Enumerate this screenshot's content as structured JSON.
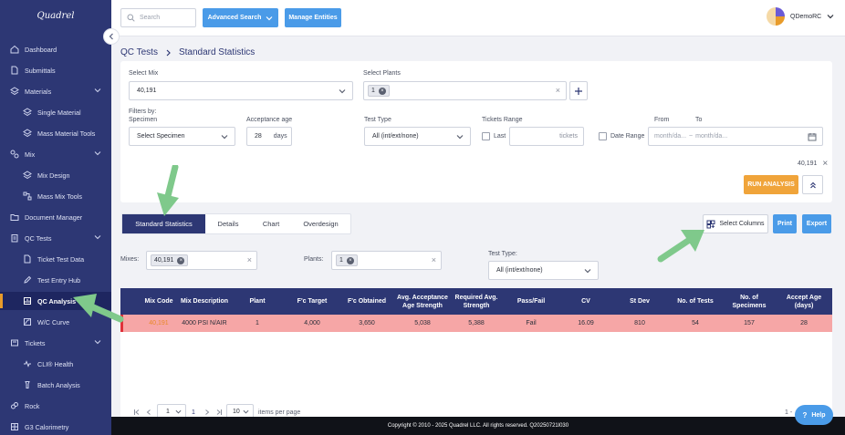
{
  "app": {
    "logo": "Quadrel"
  },
  "sidebar": {
    "items": [
      {
        "label": "Dashboard",
        "icon": "dashboard-icon"
      },
      {
        "label": "Submittals",
        "icon": "file-icon"
      },
      {
        "label": "Materials",
        "icon": "layers-icon"
      },
      {
        "label": "Single Material",
        "icon": "layers-icon"
      },
      {
        "label": "Mass Material Tools",
        "icon": "layers-icon"
      },
      {
        "label": "Mix",
        "icon": "mix-icon"
      },
      {
        "label": "Mix Design",
        "icon": "layers-icon"
      },
      {
        "label": "Mass Mix Tools",
        "icon": "tools-icon"
      },
      {
        "label": "Document Manager",
        "icon": "folder-icon"
      },
      {
        "label": "QC Tests",
        "icon": "clipboard-icon"
      },
      {
        "label": "Ticket Test Data",
        "icon": "ticket-icon"
      },
      {
        "label": "Test Entry Hub",
        "icon": "edit-icon"
      },
      {
        "label": "QC Analysis",
        "icon": "chart-icon"
      },
      {
        "label": "W/C Curve",
        "icon": "curve-icon"
      },
      {
        "label": "Tickets",
        "icon": "ticket-icon"
      },
      {
        "label": "CLI® Health",
        "icon": "health-icon"
      },
      {
        "label": "Batch Analysis",
        "icon": "batch-icon"
      },
      {
        "label": "Rock",
        "icon": "rock-icon"
      },
      {
        "label": "G3 Calorimetry",
        "icon": "grid-icon"
      }
    ]
  },
  "topbar": {
    "search_placeholder": "Search",
    "advanced_search": "Advanced Search",
    "manage_entities": "Manage Entities",
    "user_name": "QDemoRC"
  },
  "breadcrumb": {
    "parent": "QC Tests",
    "current": "Standard Statistics"
  },
  "filters": {
    "select_mix_label": "Select Mix",
    "select_mix_value": "40,191",
    "select_plants_label": "Select Plants",
    "plant_chip": "1",
    "filters_by_label": "Filters by:",
    "specimen_label": "Specimen",
    "specimen_value": "Select Specimen",
    "acceptance_age_label": "Acceptance age",
    "acceptance_age_value": "28",
    "acceptance_age_unit": "days",
    "test_type_label": "Test Type",
    "test_type_value": "All (int/ext/none)",
    "tickets_range_label": "Tickets Range",
    "last_label": "Last",
    "tickets_unit": "tickets",
    "date_range_label": "Date Range",
    "from_label": "From",
    "to_label": "To",
    "date_placeholder": "month/da...",
    "date_placeholder_2": "month/da...",
    "date_separator": "~",
    "selected_mix_tag": "40,191",
    "run_analysis": "RUN ANALYSIS"
  },
  "tabs": [
    {
      "label": "Standard Statistics",
      "active": true
    },
    {
      "label": "Details",
      "active": false
    },
    {
      "label": "Chart",
      "active": false
    },
    {
      "label": "Overdesign",
      "active": false
    }
  ],
  "actions": {
    "select_columns": "Select Columns",
    "print": "Print",
    "export": "Export"
  },
  "table_filters": {
    "mixes_label": "Mixes:",
    "mix_chip": "40,191",
    "plants_label": "Plants:",
    "plant_chip": "1",
    "test_type_label": "Test Type:",
    "test_type_value": "All (int/ext/none)"
  },
  "table": {
    "headers": [
      "Mix Code",
      "Mix Description",
      "Plant",
      "F'c Target",
      "F'c Obtained",
      "Avg. Acceptance Age Strength",
      "Required Avg. Strength",
      "Pass/Fail",
      "CV",
      "St Dev",
      "No. of Tests",
      "No. of Specimens",
      "Accept Age (days)"
    ],
    "rows": [
      [
        "40,191",
        "4000 PSI N/AIR",
        "1",
        "4,000",
        "3,650",
        "5,038",
        "5,388",
        "Fail",
        "16.09",
        "810",
        "54",
        "157",
        "28"
      ]
    ],
    "mix_code_color": "#e8892a"
  },
  "pager": {
    "page": "1",
    "page_link": "1",
    "page_size": "10",
    "items_per_page": "items per page",
    "range_info": "1 -"
  },
  "footer": {
    "copyright": "Copyright © 2010 - 2025 Quadrel LLC. All rights reserved. Q20250721l030"
  },
  "help": {
    "label": "Help"
  },
  "colors": {
    "sidebar": "#2d3774",
    "accent_blue": "#4a9be8",
    "accent_orange": "#f0a43a",
    "fail_row": "#f6a6a6",
    "arrow_green": "#7fc98b"
  }
}
